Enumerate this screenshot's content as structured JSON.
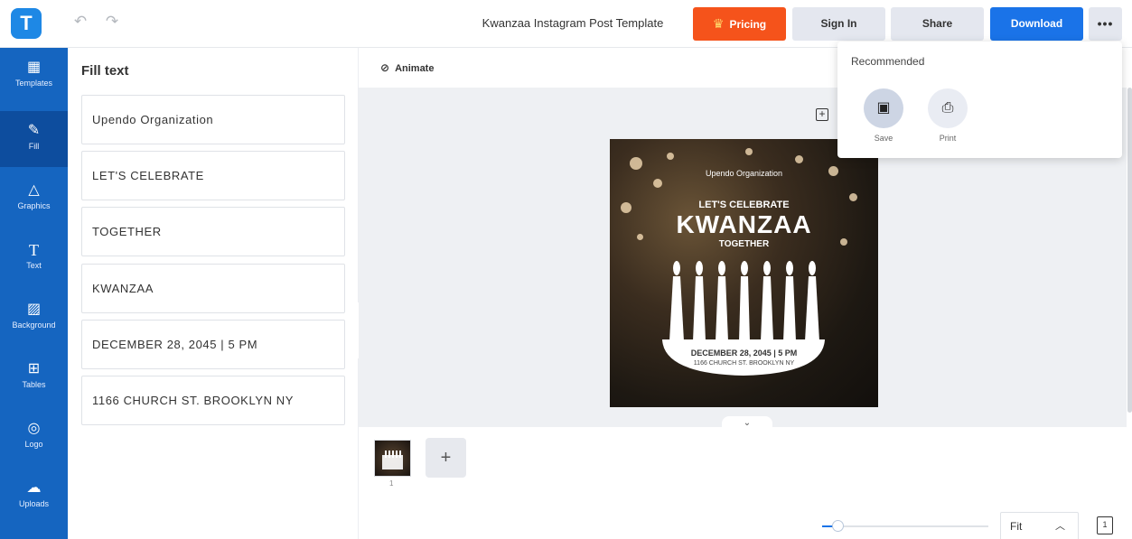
{
  "topbar": {
    "logo_letter": "T",
    "document_title": "Kwanzaa Instagram Post Template",
    "pricing_label": "Pricing",
    "signin_label": "Sign In",
    "share_label": "Share",
    "download_label": "Download",
    "more_label": "•••"
  },
  "sidebar": {
    "items": [
      {
        "label": "Templates",
        "icon": "templates-icon"
      },
      {
        "label": "Fill",
        "icon": "pencil-icon"
      },
      {
        "label": "Graphics",
        "icon": "shapes-icon"
      },
      {
        "label": "Text",
        "icon": "text-icon"
      },
      {
        "label": "Background",
        "icon": "background-icon"
      },
      {
        "label": "Tables",
        "icon": "table-icon"
      },
      {
        "label": "Logo",
        "icon": "logo-icon"
      },
      {
        "label": "Uploads",
        "icon": "upload-cloud-icon"
      }
    ]
  },
  "panel": {
    "title": "Fill text",
    "fields": [
      "Upendo Organization",
      "LET'S CELEBRATE",
      "TOGETHER",
      "KWANZAA",
      "DECEMBER 28, 2045 | 5 PM",
      "1166 CHURCH ST. BROOKLYN NY"
    ]
  },
  "toolbar": {
    "animate_label": "Animate"
  },
  "poster": {
    "org": "Upendo Organization",
    "lets": "LET'S CELEBRATE",
    "kwanzaa": "KWANZAA",
    "together": "TOGETHER",
    "date": "DECEMBER 28, 2045 | 5 PM",
    "address": "1166 CHURCH ST. BROOKLYN NY"
  },
  "pages": {
    "thumb_number": "1",
    "add_label": "+"
  },
  "zoom": {
    "level_label": "Fit",
    "slider_fraction": 0.09
  },
  "dropdown": {
    "title": "Recommended",
    "save_label": "Save",
    "print_label": "Print"
  },
  "colors": {
    "brand_blue": "#1565c0",
    "pricing_orange": "#f5531b",
    "download_blue": "#1a73e8"
  }
}
